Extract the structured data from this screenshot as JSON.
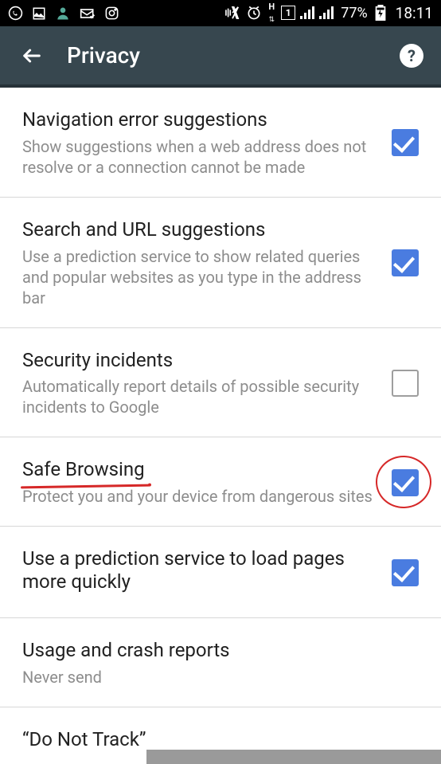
{
  "status_bar": {
    "battery_pct": "77%",
    "time": "18:11",
    "net_label": "H",
    "sim_slot": "1"
  },
  "app_bar": {
    "title": "Privacy"
  },
  "items": [
    {
      "title": "Navigation error suggestions",
      "desc": "Show suggestions when a web address does not resolve or a connection cannot be made",
      "checked": true,
      "has_checkbox": true
    },
    {
      "title": "Search and URL suggestions",
      "desc": "Use a prediction service to show related queries and popular websites as you type in the address bar",
      "checked": true,
      "has_checkbox": true
    },
    {
      "title": "Security incidents",
      "desc": "Automatically report details of possible security incidents to Google",
      "checked": false,
      "has_checkbox": true
    },
    {
      "title": "Safe Browsing",
      "desc": "Protect you and your device from dangerous sites",
      "checked": true,
      "has_checkbox": true,
      "highlight": true
    },
    {
      "title": "Use a prediction service to load pages more quickly",
      "desc": "",
      "checked": true,
      "has_checkbox": true
    },
    {
      "title": "Usage and crash reports",
      "desc": "Never send",
      "checked": false,
      "has_checkbox": false
    }
  ],
  "last_item": {
    "title": "“Do Not Track”"
  }
}
